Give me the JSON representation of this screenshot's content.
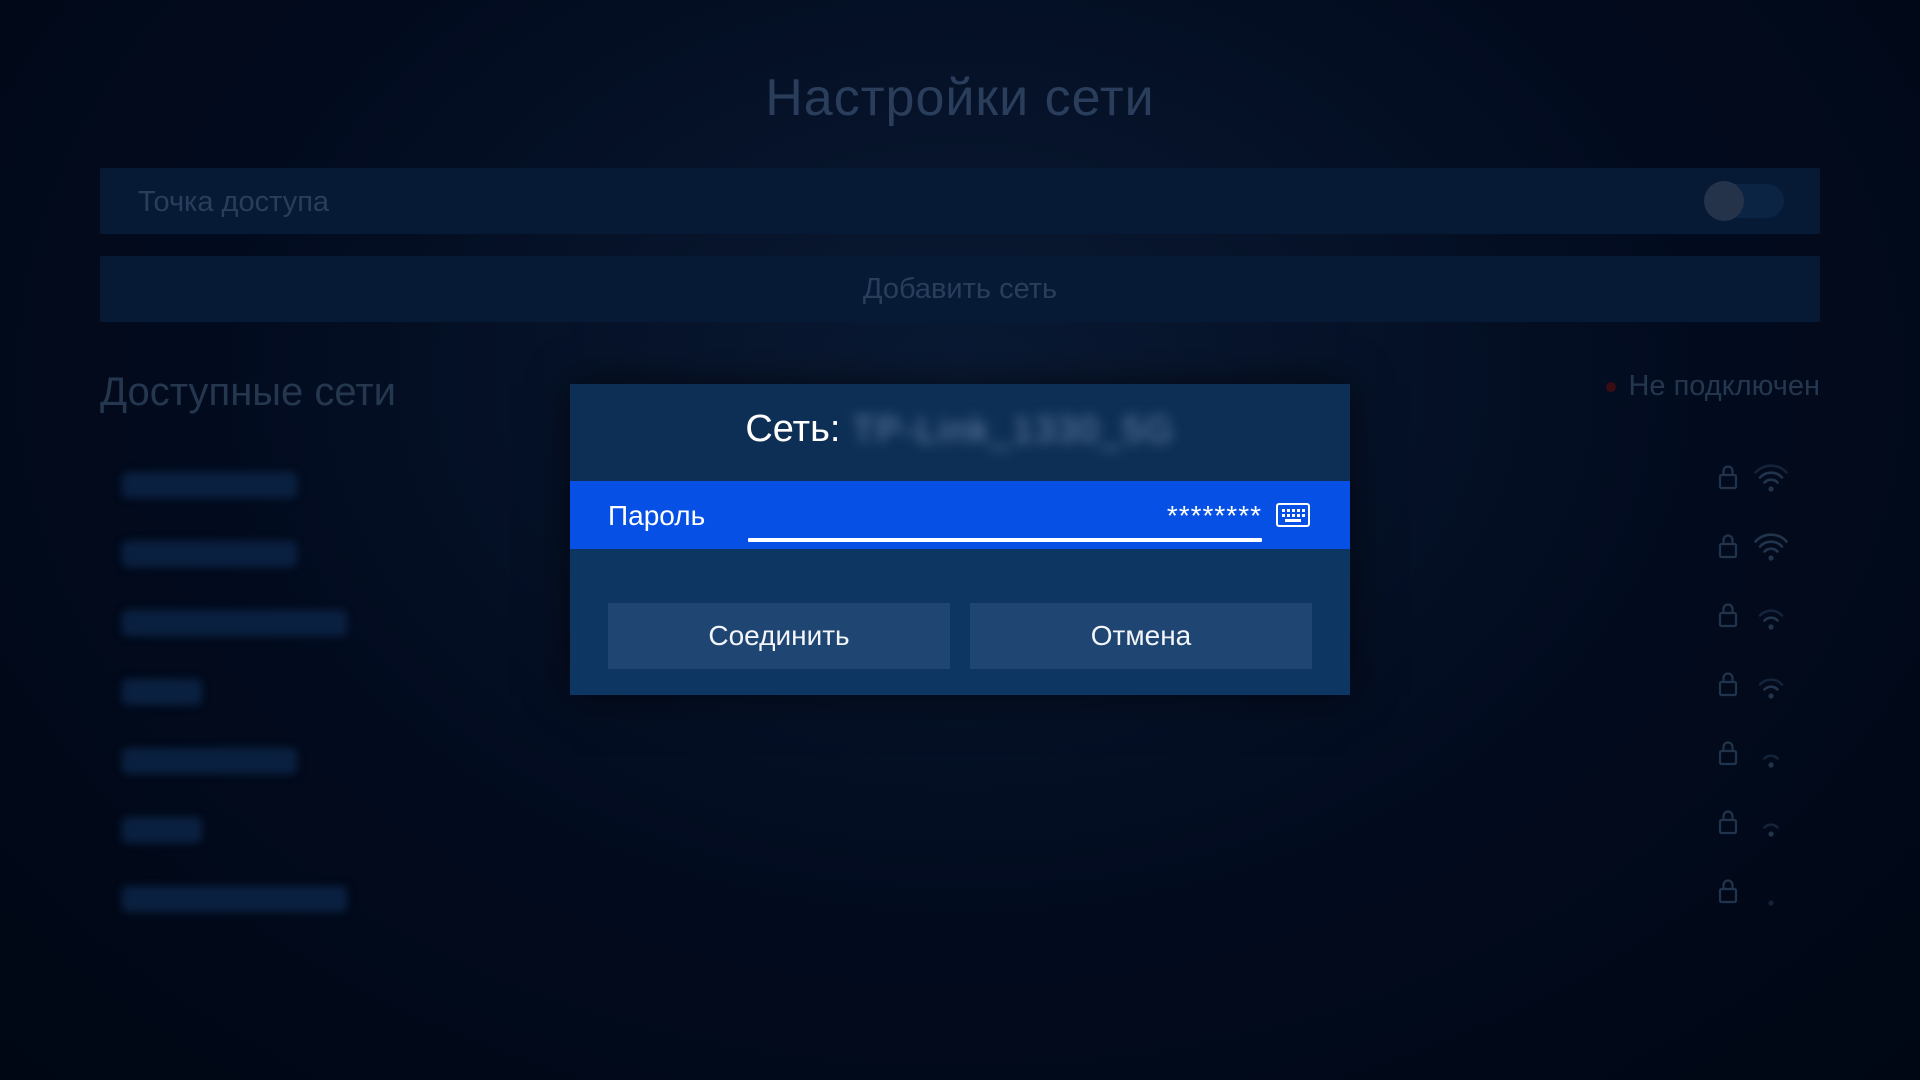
{
  "background": {
    "title": "Настройки сети",
    "hotspot_label": "Точка доступа",
    "hotspot_enabled": false,
    "add_network_label": "Добавить сеть",
    "available_networks_title": "Доступные сети",
    "connection_status": "Не подключен",
    "status_color": "#3a0c14",
    "networks": [
      {
        "secured": true,
        "signal": 3
      },
      {
        "secured": true,
        "signal": 4
      },
      {
        "secured": true,
        "signal": 2
      },
      {
        "secured": true,
        "signal": 2
      },
      {
        "secured": true,
        "signal": 1
      },
      {
        "secured": true,
        "signal": 1
      },
      {
        "secured": true,
        "signal": 0
      }
    ]
  },
  "dialog": {
    "title_prefix": "Сеть:",
    "ssid": "TP-Link_1330_5G",
    "password_label": "Пароль",
    "password_value": "********",
    "keyboard_icon": "keyboard-icon",
    "connect_label": "Соединить",
    "cancel_label": "Отмена",
    "accent_color": "#0650e6"
  }
}
